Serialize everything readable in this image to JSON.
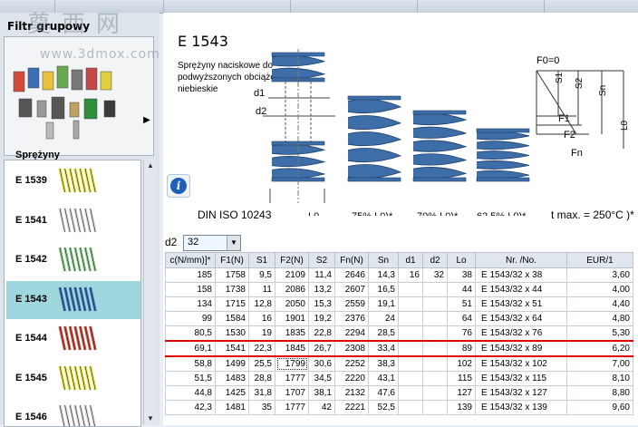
{
  "watermark": {
    "text": "奠西网",
    "url": "www.3dmox.com"
  },
  "sidebar": {
    "filter_title": "Filtr grupowy",
    "filter_label": "Sprężyny",
    "filter_arrow": "▶",
    "items": [
      {
        "name": "E 1539",
        "color": "#e8e23a"
      },
      {
        "name": "E 1541",
        "color": "#d8d8d8"
      },
      {
        "name": "E 1542",
        "color": "#8fcf8f"
      },
      {
        "name": "E 1543",
        "color": "#3a6fb8"
      },
      {
        "name": "E 1544",
        "color": "#d44a3a"
      },
      {
        "name": "E 1545",
        "color": "#e8e23a"
      },
      {
        "name": "E 1546",
        "color": "#d8d8d8"
      }
    ],
    "selected": "E 1543"
  },
  "product": {
    "title": "E 1543",
    "description": "Sprężyny naciskowe do podwyższonych obciążeń, niebieskie",
    "standard": "DIN ISO 10243",
    "tmax": "t max. = 250°C )*",
    "spring_color": "#3d6ea8"
  },
  "drawing": {
    "d1": "d1",
    "d2": "d2",
    "L0": "L0",
    "p75": "75% L0)*",
    "p70": "70% L0)*",
    "p625": "62.5% L0)*",
    "F0": "F0=0",
    "F1": "F1",
    "F2": "F2",
    "Fn": "Fn",
    "S1": "S1",
    "S2": "S2",
    "Sn": "Sn",
    "L0v": "L0"
  },
  "filter": {
    "label": "d2",
    "value": "32"
  },
  "table": {
    "headers": [
      "c(N/mm)]*",
      "F1(N)",
      "S1",
      "F2(N)",
      "S2",
      "Fn(N)",
      "Sn",
      "d1",
      "d2",
      "Lo",
      "Nr. /No.",
      "EUR/1"
    ],
    "rows": [
      [
        "185",
        "1758",
        "9,5",
        "2109",
        "11,4",
        "2646",
        "14,3",
        "16",
        "32",
        "38",
        "E 1543/32   x  38",
        "3,60"
      ],
      [
        "158",
        "1738",
        "11",
        "2086",
        "13,2",
        "2607",
        "16,5",
        "",
        "",
        "44",
        "E 1543/32   x  44",
        "4,00"
      ],
      [
        "134",
        "1715",
        "12,8",
        "2050",
        "15,3",
        "2559",
        "19,1",
        "",
        "",
        "51",
        "E 1543/32   x  51",
        "4,40"
      ],
      [
        "99",
        "1584",
        "16",
        "1901",
        "19,2",
        "2376",
        "24",
        "",
        "",
        "64",
        "E 1543/32   x  64",
        "4,80"
      ],
      [
        "80,5",
        "1530",
        "19",
        "1835",
        "22,8",
        "2294",
        "28,5",
        "",
        "",
        "76",
        "E 1543/32   x  76",
        "5,30"
      ],
      [
        "69,1",
        "1541",
        "22,3",
        "1845",
        "26,7",
        "2308",
        "33,4",
        "",
        "",
        "89",
        "E 1543/32   x  89",
        "6,20"
      ],
      [
        "58,8",
        "1499",
        "25,5",
        "1799",
        "30,6",
        "2252",
        "38,3",
        "",
        "",
        "102",
        "E 1543/32   x 102",
        "7,00"
      ],
      [
        "51,5",
        "1483",
        "28,8",
        "1777",
        "34,5",
        "2220",
        "43,1",
        "",
        "",
        "115",
        "E 1543/32   x 115",
        "8,10"
      ],
      [
        "44,8",
        "1425",
        "31,8",
        "1707",
        "38,1",
        "2132",
        "47,6",
        "",
        "",
        "127",
        "E 1543/32   x 127",
        "8,80"
      ],
      [
        "42,3",
        "1481",
        "35",
        "1777",
        "42",
        "2221",
        "52,5",
        "",
        "",
        "139",
        "E 1543/32   x 139",
        "9,60"
      ]
    ],
    "highlighted_row": 5
  }
}
